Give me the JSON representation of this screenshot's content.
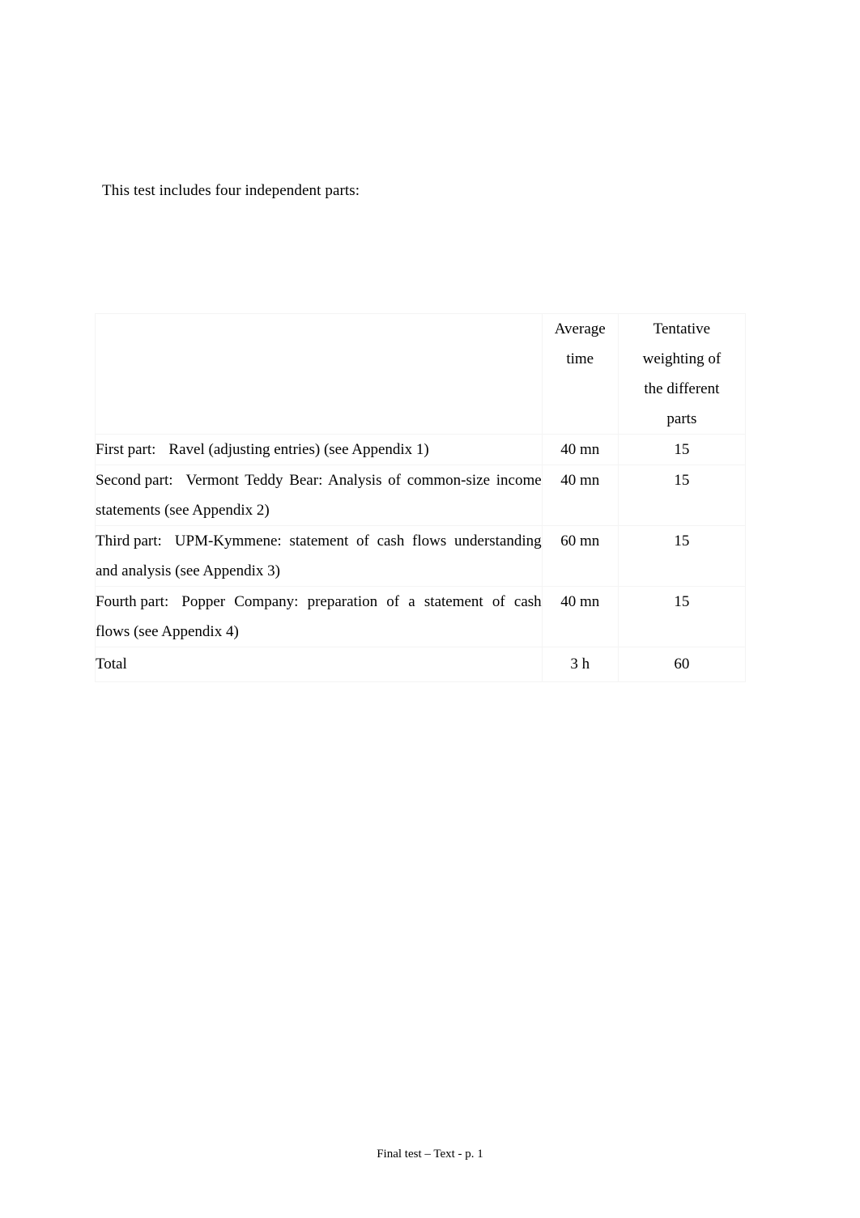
{
  "document": {
    "intro_text": "This test includes four independent parts:",
    "footer_text": "Final test – Text - p. 1"
  },
  "table": {
    "headers": {
      "description": "",
      "average_time": "Average time",
      "average_time_line1": "Average",
      "average_time_line2": "time",
      "weighting": "Tentative weighting of the different parts",
      "weighting_line1": "Tentative",
      "weighting_line2": "weighting of",
      "weighting_line3": "the different",
      "weighting_line4": "parts"
    },
    "rows": [
      {
        "label": "First part:",
        "description": "Ravel (adjusting entries) (see Appendix 1)",
        "average_time": "40 mn",
        "weighting": "15"
      },
      {
        "label": "Second part:",
        "description": "Vermont Teddy Bear: Analysis of common-size income statements (see Appendix 2)",
        "average_time": "40 mn",
        "weighting": "15"
      },
      {
        "label": "Third part:",
        "description": "UPM-Kymmene: statement of cash flows understanding and analysis (see Appendix 3)",
        "average_time": "60 mn",
        "weighting": "15"
      },
      {
        "label": "Fourth part:",
        "description": "Popper Company: preparation of a statement of cash flows (see Appendix 4)",
        "average_time": "40 mn",
        "weighting": "15"
      }
    ],
    "total_row": {
      "label": "Total",
      "average_time": "3 h",
      "weighting": "60"
    }
  },
  "colors": {
    "page_background": "#ffffff",
    "text": "#000000",
    "table_border": "#f4f4f4"
  }
}
